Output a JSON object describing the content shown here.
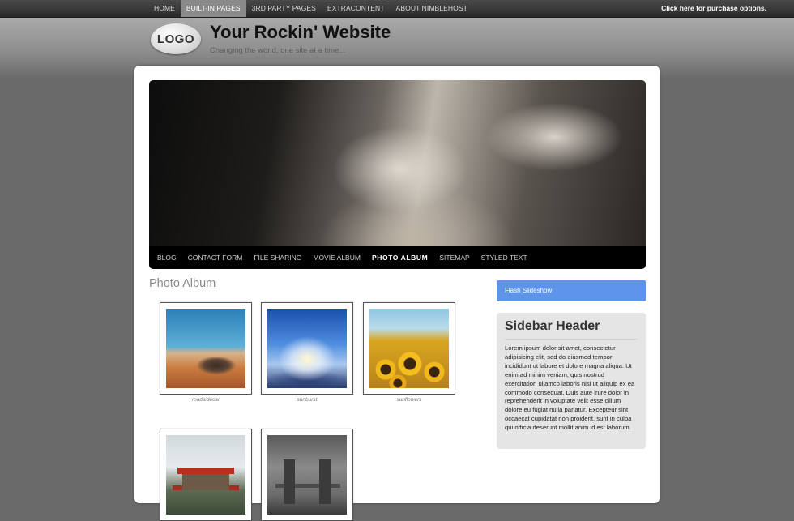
{
  "top_nav": {
    "items": [
      {
        "label": "HOME",
        "active": false
      },
      {
        "label": "BUILT-IN PAGES",
        "active": true
      },
      {
        "label": "3RD PARTY PAGES",
        "active": false
      },
      {
        "label": "EXTRACONTENT",
        "active": false
      },
      {
        "label": "ABOUT NIMBLEHOST",
        "active": false
      }
    ],
    "purchase_link": "Click here for purchase options."
  },
  "header": {
    "logo_text": "LOGO",
    "site_title": "Your Rockin' Website",
    "tagline": "Changing the world, one site at a time..."
  },
  "sub_nav": {
    "items": [
      {
        "label": "BLOG",
        "active": false
      },
      {
        "label": "CONTACT FORM",
        "active": false
      },
      {
        "label": "FILE SHARING",
        "active": false
      },
      {
        "label": "MOVIE ALBUM",
        "active": false
      },
      {
        "label": "PHOTO ALBUM",
        "active": true
      },
      {
        "label": "SITEMAP",
        "active": false
      },
      {
        "label": "STYLED TEXT",
        "active": false
      }
    ]
  },
  "main": {
    "page_title": "Photo Album",
    "photos": [
      {
        "caption": "roadsidecar"
      },
      {
        "caption": "sunburst"
      },
      {
        "caption": "sunflowers"
      },
      {
        "caption": ""
      },
      {
        "caption": ""
      }
    ]
  },
  "sidebar": {
    "flash_button": "Flash Slideshow",
    "header": "Sidebar Header",
    "body": "Lorem ipsum dolor sit amet, consectetur adipisicing elit, sed do eiusmod tempor incididunt ut labore et dolore magna aliqua. Ut enim ad minim veniam, quis nostrud exercitation ullamco laboris nisi ut aliquip ex ea commodo consequat. Duis aute irure dolor in reprehenderit in voluptate velit esse cillum dolore eu fugiat nulla pariatur. Excepteur sint occaecat cupidatat non proident, sunt in culpa qui officia deserunt mollit anim id est laborum."
  },
  "colors": {
    "accent_blue": "#5e94ea",
    "nav_active_bg": "#8a8a8a"
  }
}
